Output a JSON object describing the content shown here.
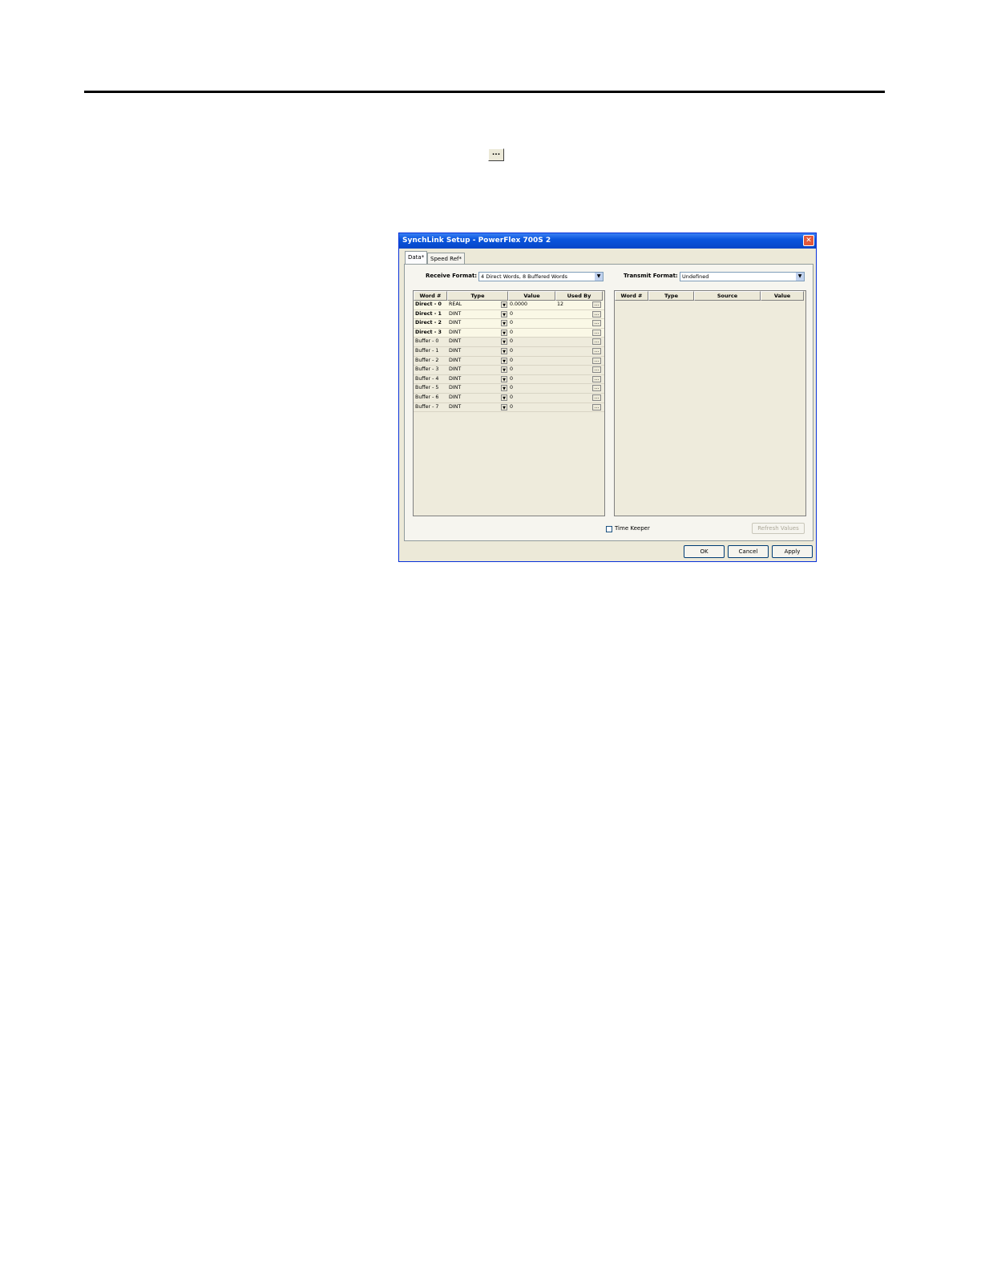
{
  "page": {
    "ellipsis_sample_label": "..."
  },
  "dialog": {
    "title": "SynchLink Setup - PowerFlex 700S 2",
    "close_glyph": "✕",
    "tabs": [
      {
        "label": "Data*"
      },
      {
        "label": "Speed Ref*"
      }
    ],
    "receive_format": {
      "label": "Receive Format:",
      "value": "4 Direct Words, 8 Buffered Words"
    },
    "transmit_format": {
      "label": "Transmit Format:",
      "value": "Undefined"
    },
    "receive_table": {
      "headers": [
        "Word #",
        "Type",
        "Value",
        "Used By"
      ],
      "rows": [
        {
          "word": "Direct - 0",
          "type": "REAL",
          "value": "0.0000",
          "used_by": "12"
        },
        {
          "word": "Direct - 1",
          "type": "DINT",
          "value": "0",
          "used_by": ""
        },
        {
          "word": "Direct - 2",
          "type": "DINT",
          "value": "0",
          "used_by": ""
        },
        {
          "word": "Direct - 3",
          "type": "DINT",
          "value": "0",
          "used_by": ""
        },
        {
          "word": "Buffer - 0",
          "type": "DINT",
          "value": "0",
          "used_by": ""
        },
        {
          "word": "Buffer - 1",
          "type": "DINT",
          "value": "0",
          "used_by": ""
        },
        {
          "word": "Buffer - 2",
          "type": "DINT",
          "value": "0",
          "used_by": ""
        },
        {
          "word": "Buffer - 3",
          "type": "DINT",
          "value": "0",
          "used_by": ""
        },
        {
          "word": "Buffer - 4",
          "type": "DINT",
          "value": "0",
          "used_by": ""
        },
        {
          "word": "Buffer - 5",
          "type": "DINT",
          "value": "0",
          "used_by": ""
        },
        {
          "word": "Buffer - 6",
          "type": "DINT",
          "value": "0",
          "used_by": ""
        },
        {
          "word": "Buffer - 7",
          "type": "DINT",
          "value": "0",
          "used_by": ""
        }
      ]
    },
    "transmit_table": {
      "headers": [
        "Word #",
        "Type",
        "Source",
        "Value"
      ]
    },
    "time_keeper_label": "Time Keeper",
    "refresh_values_label": "Refresh Values",
    "ok_label": "OK",
    "cancel_label": "Cancel",
    "apply_label": "Apply",
    "ellipsis_glyph": "...",
    "dropdown_glyph": "▼"
  }
}
